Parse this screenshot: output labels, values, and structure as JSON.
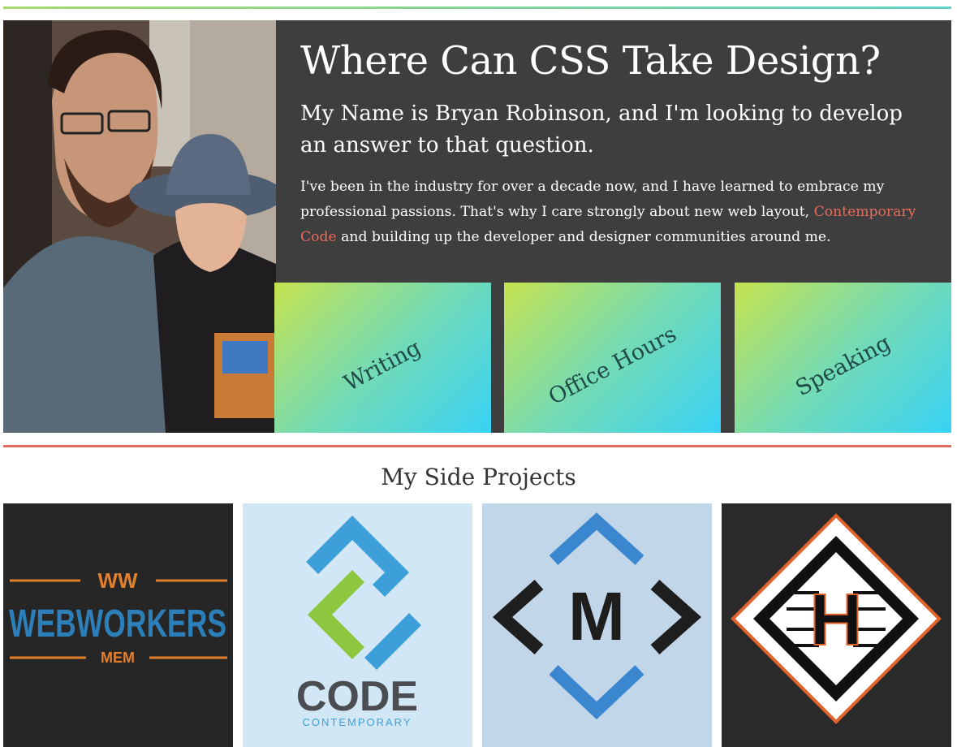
{
  "hero": {
    "title": "Where Can CSS Take Design?",
    "subtitle": "My Name is Bryan Robinson, and I'm looking to develop an answer to that question.",
    "body_before": "I've been in the industry for over a decade now, and I have learned to embrace my professional passions. That's why I care strongly about new web layout, ",
    "link_text": "Contemporary Code",
    "body_after": " and building up the developer and designer communities around me.",
    "photo_icon": "portrait-photo"
  },
  "tiles": [
    {
      "label": "Writing"
    },
    {
      "label": "Office Hours"
    },
    {
      "label": "Speaking"
    }
  ],
  "projects": {
    "title": "My Side Projects",
    "items": [
      {
        "icon": "webworkers-logo",
        "top_text": "WW",
        "main_text": "WEBWORKERS",
        "bottom_text": "MEM"
      },
      {
        "icon": "code-contemporary-logo",
        "main_text": "CODE",
        "bottom_text": "CONTEMPORARY"
      },
      {
        "icon": "m-diamond-logo",
        "main_text": "M"
      },
      {
        "icon": "h-circuit-logo",
        "main_text": "H"
      }
    ]
  },
  "colors": {
    "accent_red": "#e36d5c",
    "link": "#ec6a5a",
    "hero_bg": "#3e3e3e",
    "tile_gradient_start": "#c7e34f",
    "tile_gradient_end": "#38d2f6",
    "tile_text": "#1f4a47"
  }
}
